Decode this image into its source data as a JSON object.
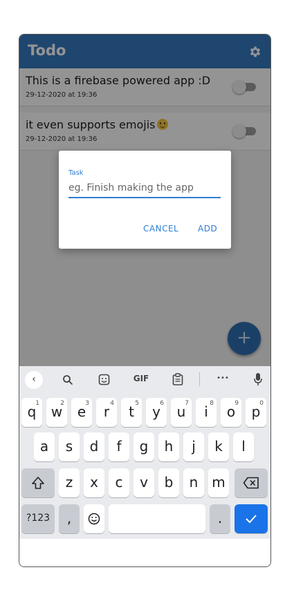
{
  "app": {
    "title": "Todo",
    "settings_icon": "gear-icon",
    "bar_color": "#3479c0"
  },
  "todos": [
    {
      "text": "This is a firebase powered app :D",
      "date": "29-12-2020 at 19:36",
      "emoji": ""
    },
    {
      "text": "it even supports emojis",
      "date": "29-12-2020 at 19:36",
      "emoji": "smiling-face"
    }
  ],
  "dialog": {
    "label": "Task",
    "placeholder": "eg. Finish making the app",
    "cancel": "CANCEL",
    "add": "ADD",
    "accent": "#2d7dd2"
  },
  "fab": {
    "label": "+",
    "icon": "plus-icon"
  },
  "keyboard": {
    "toolbar": {
      "back": "‹",
      "search": "search-icon",
      "sticker": "sticker-icon",
      "gif": "GIF",
      "clipboard": "clipboard-icon",
      "more": "•••",
      "mic": "mic-icon"
    },
    "row1": [
      "q",
      "w",
      "e",
      "r",
      "t",
      "y",
      "u",
      "i",
      "o",
      "p"
    ],
    "row1_numbers": [
      "1",
      "2",
      "3",
      "4",
      "5",
      "6",
      "7",
      "8",
      "9",
      "0"
    ],
    "row2": [
      "a",
      "s",
      "d",
      "f",
      "g",
      "h",
      "j",
      "k",
      "l"
    ],
    "row3": [
      "z",
      "x",
      "c",
      "v",
      "b",
      "n",
      "m"
    ],
    "symbols": "?123",
    "comma": ",",
    "period": ".",
    "enter_icon": "check-icon",
    "shift_icon": "shift-icon",
    "backspace_icon": "backspace-icon",
    "emoji_icon": "emoji-icon"
  }
}
